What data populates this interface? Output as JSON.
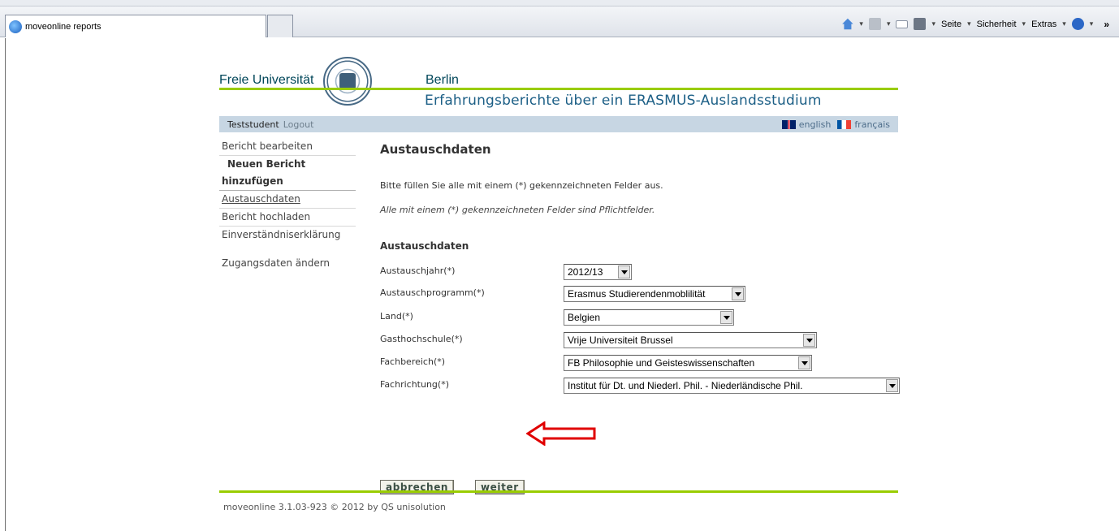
{
  "browser": {
    "tab_title": "moveonline reports",
    "commands": {
      "page": "Seite",
      "safety": "Sicherheit",
      "extras": "Extras",
      "chevron": "»"
    }
  },
  "header": {
    "logo_left": "Freie Universität",
    "logo_right": "Berlin",
    "subtitle": "Erfahrungsberichte über ein ERASMUS-Auslandsstudium"
  },
  "userbar": {
    "user": "Teststudent",
    "logout": "Logout",
    "lang_en": "english",
    "lang_fr": "français"
  },
  "sidebar": {
    "items": [
      {
        "label": "Bericht bearbeiten"
      },
      {
        "label": "Neuen Bericht"
      },
      {
        "label": "hinzufügen"
      },
      {
        "label": "Austauschdaten"
      },
      {
        "label": "Bericht hochladen"
      },
      {
        "label": "Einverständniserklärung"
      },
      {
        "label": "Zugangsdaten ändern"
      }
    ]
  },
  "main": {
    "title": "Austauschdaten",
    "intro": "Bitte füllen Sie alle mit einem (*) gekennzeichneten Felder aus.",
    "note": "Alle mit einem (*) gekennzeichneten Felder sind Pflichtfelder.",
    "section": "Austauschdaten",
    "fields": [
      {
        "label": "Austauschjahr(*)",
        "value": "2012/13"
      },
      {
        "label": "Austauschprogramm(*)",
        "value": "Erasmus Studierendenmoblilität"
      },
      {
        "label": "Land(*)",
        "value": "Belgien"
      },
      {
        "label": "Gasthochschule(*)",
        "value": "Vrije Universiteit Brussel"
      },
      {
        "label": "Fachbereich(*)",
        "value": "FB Philosophie und Geisteswissenschaften"
      },
      {
        "label": "Fachrichtung(*)",
        "value": "Institut für Dt. und Niederl. Phil. - Niederländische Phil."
      }
    ],
    "cancel_label": "abbrechen",
    "next_label": "weiter"
  },
  "footer": {
    "text": "moveonline 3.1.03-923 © 2012 by QS unisolution"
  },
  "colors": {
    "accent_green": "#99cc00",
    "userbar_bg": "#c7d6e3",
    "annotation_red": "#e00000"
  }
}
